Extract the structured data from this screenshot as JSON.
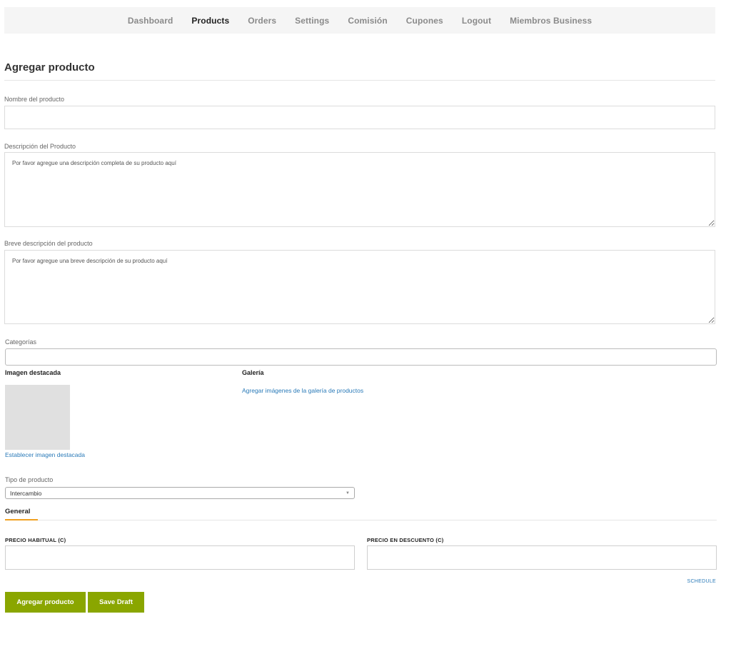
{
  "nav": {
    "items": [
      {
        "label": "Dashboard",
        "active": false
      },
      {
        "label": "Products",
        "active": true
      },
      {
        "label": "Orders",
        "active": false
      },
      {
        "label": "Settings",
        "active": false
      },
      {
        "label": "Comisión",
        "active": false
      },
      {
        "label": "Cupones",
        "active": false
      },
      {
        "label": "Logout",
        "active": false
      },
      {
        "label": "Miembros Business",
        "active": false
      }
    ]
  },
  "page": {
    "title": "Agregar producto"
  },
  "form": {
    "product_name": {
      "label": "Nombre del producto",
      "value": ""
    },
    "description": {
      "label": "Descripción del Producto",
      "placeholder": "Por favor agregue una descripción completa de su producto aquí",
      "value": ""
    },
    "short_description": {
      "label": "Breve descripción del producto",
      "placeholder": "Por favor agregue una breve descripción de su producto aquí",
      "value": ""
    },
    "categories": {
      "label": "Categorías",
      "value": ""
    },
    "featured_image": {
      "label": "Imagen destacada",
      "link": "Establecer imagen destacada"
    },
    "gallery": {
      "label": "Galería",
      "link": "Agregar imágenes de la galería de productos"
    },
    "product_type": {
      "label": "Tipo de producto",
      "selected": "Intercambio"
    },
    "tabs": {
      "general": "General"
    },
    "regular_price": {
      "label": "PRECIO HABITUAL (C)",
      "value": ""
    },
    "sale_price": {
      "label": "PRECIO EN DESCUENTO (C)",
      "value": ""
    },
    "schedule_link": "SCHEDULE",
    "submit_label": "Agregar producto",
    "draft_label": "Save Draft"
  },
  "colors": {
    "accent_button": "#8aa600",
    "tab_underline": "#f0a020",
    "link": "#2a7ab8"
  }
}
